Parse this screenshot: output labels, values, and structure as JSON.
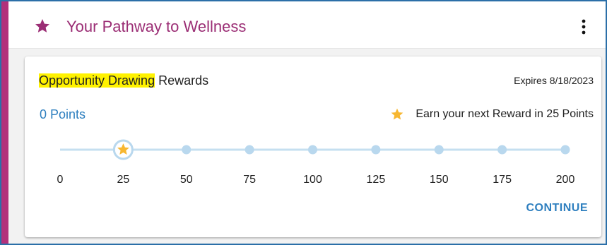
{
  "header": {
    "title": "Your Pathway to Wellness",
    "icon": "star-icon",
    "menu_icon": "more-vertical-icon"
  },
  "card": {
    "title_highlight": "Opportunity Drawing",
    "title_rest": " Rewards",
    "expires": "Expires 8/18/2023",
    "points": "0 Points",
    "next_reward": "Earn your next Reward in 25 Points",
    "continue_label": "CONTINUE"
  },
  "progress": {
    "current_points": 0,
    "reward_at": 25,
    "ticks": [
      "0",
      "25",
      "50",
      "75",
      "100",
      "125",
      "150",
      "175",
      "200"
    ]
  },
  "colors": {
    "accent": "#b2317b",
    "title": "#9b2e75",
    "link": "#2e7fbf",
    "highlight": "#fff200",
    "star": "#f7b731",
    "track": "#c5dff0",
    "dot": "#b9d8ee"
  }
}
